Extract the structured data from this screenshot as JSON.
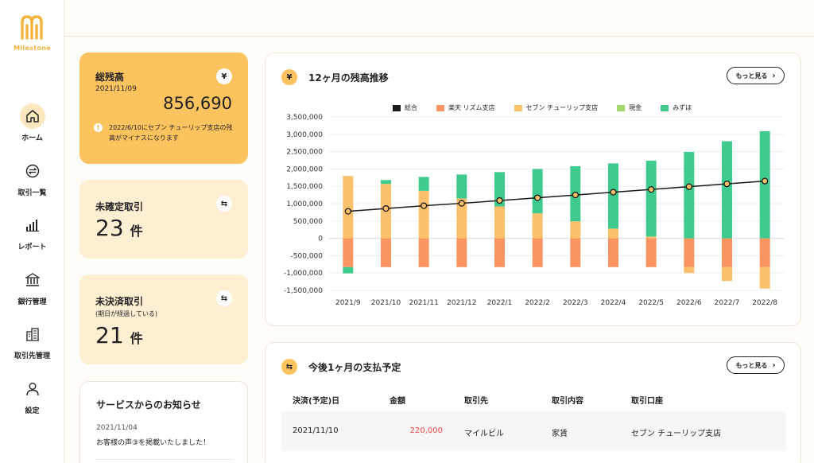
{
  "brand": {
    "name": "Milestone",
    "color": "#f3b43d"
  },
  "nav": [
    {
      "label": "ホーム",
      "icon": "home-icon",
      "active": true
    },
    {
      "label": "取引一覧",
      "icon": "transfer-icon",
      "active": false
    },
    {
      "label": "レポート",
      "icon": "report-icon",
      "active": false
    },
    {
      "label": "銀行管理",
      "icon": "bank-icon",
      "active": false
    },
    {
      "label": "取引先管理",
      "icon": "building-icon",
      "active": false
    },
    {
      "label": "設定",
      "icon": "user-icon",
      "active": false
    }
  ],
  "balance": {
    "title": "総残高",
    "date": "2021/11/09",
    "amount": "856,690",
    "icon": "yen-icon",
    "warning": "2022/6/10にセブン チューリップ支店の残高がマイナスになります"
  },
  "pending": {
    "title": "未確定取引",
    "count": "23",
    "unit": "件",
    "icon": "transfer-icon"
  },
  "unsettled": {
    "title": "未決済取引",
    "note": "(期日が経過している)",
    "count": "21",
    "unit": "件",
    "icon": "transfer-icon"
  },
  "news": {
    "title": "サービスからのお知らせ",
    "items": [
      {
        "date": "2021/11/04",
        "text": "お客様の声③を掲載いたしました！"
      }
    ]
  },
  "chart_panel": {
    "title": "12ヶ月の残高推移",
    "more_label": "もっと見る",
    "icon": "yen-icon"
  },
  "chart_data": {
    "type": "bar",
    "title": "",
    "xlabel": "",
    "ylabel": "",
    "ylim": [
      -1500000,
      3500000
    ],
    "yticks": [
      3500000,
      3000000,
      2500000,
      2000000,
      1500000,
      1000000,
      500000,
      0,
      -500000,
      -1000000,
      -1500000
    ],
    "ytick_labels": [
      "3,500,000",
      "3,000,000",
      "2,500,000",
      "2,000,000",
      "1,500,000",
      "1,000,000",
      "500,000",
      "0",
      "-500,000",
      "-1,000,000",
      "-1,500,000"
    ],
    "grid": true,
    "legend_position": "top",
    "categories": [
      "2021/9",
      "2021/10",
      "2021/11",
      "2021/12",
      "2022/1",
      "2022/2",
      "2022/3",
      "2022/4",
      "2022/5",
      "2022/6",
      "2022/7",
      "2022/8"
    ],
    "series": [
      {
        "name": "総合",
        "type": "line",
        "color": "#1a1a1a",
        "values": [
          780000,
          860000,
          940000,
          1010000,
          1090000,
          1170000,
          1250000,
          1330000,
          1410000,
          1490000,
          1570000,
          1650000
        ]
      },
      {
        "name": "楽天 リズム支店",
        "type": "bar",
        "color": "#fa9562",
        "values": [
          -830000,
          -830000,
          -830000,
          -830000,
          -830000,
          -830000,
          -830000,
          -830000,
          -830000,
          -830000,
          -830000,
          -830000
        ]
      },
      {
        "name": "セブン チューリップ支店",
        "type": "bar",
        "color": "#fdc06d",
        "values": [
          1800000,
          1570000,
          1370000,
          1150000,
          920000,
          720000,
          490000,
          280000,
          50000,
          -170000,
          -400000,
          -620000
        ]
      },
      {
        "name": "現金",
        "type": "bar",
        "color": "#a5d768",
        "values": [
          0,
          0,
          0,
          0,
          0,
          0,
          0,
          0,
          0,
          0,
          0,
          0
        ]
      },
      {
        "name": "みずほ",
        "type": "bar",
        "color": "#3fca8e",
        "values": [
          -180000,
          110000,
          400000,
          690000,
          990000,
          1280000,
          1590000,
          1880000,
          2190000,
          2490000,
          2800000,
          3090000
        ]
      }
    ]
  },
  "schedule": {
    "title": "今後1ヶ月の支払予定",
    "more_label": "もっと見る",
    "icon": "transfer-icon",
    "columns": [
      "決済(予定)日",
      "金額",
      "取引先",
      "取引内容",
      "取引口座"
    ],
    "rows": [
      {
        "date": "2021/11/10",
        "amount": "220,000",
        "partner": "マイルビル",
        "content": "家賃",
        "account": "セブン チューリップ支店"
      }
    ],
    "amount_color": "#e8454a"
  }
}
